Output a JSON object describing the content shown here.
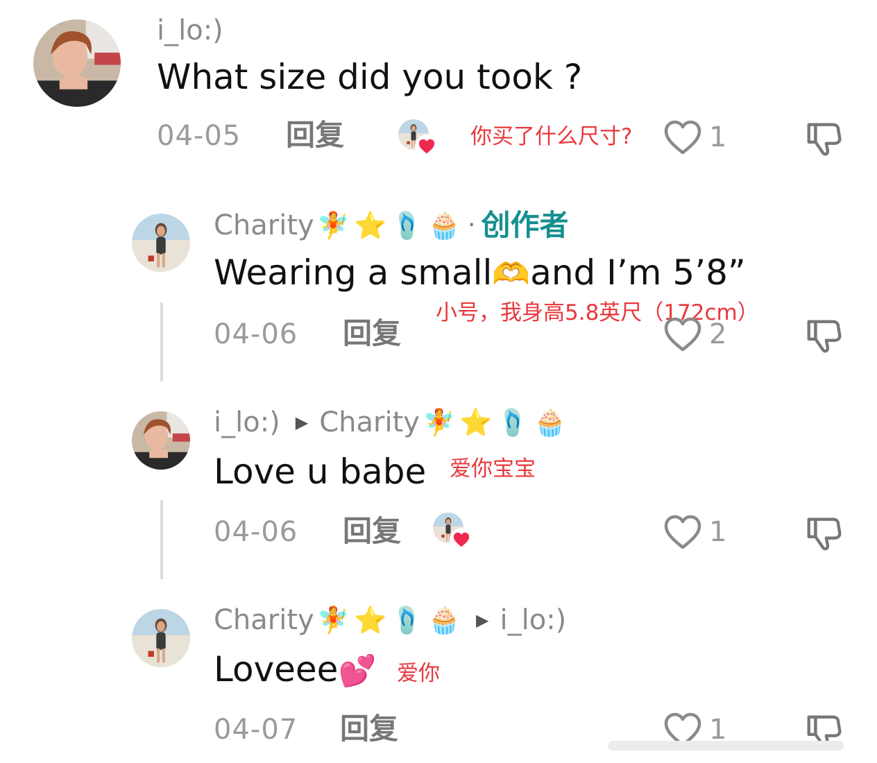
{
  "comments": [
    {
      "username": "i_lo:)",
      "text": "What size did you took ?",
      "translation": "你买了什么尺寸?",
      "date": "04-05",
      "reply_label": "回复",
      "likes": "1",
      "liked_by_creator": true
    },
    {
      "username": "Charity",
      "emojis": [
        "🧚",
        "⭐",
        "🩴",
        "🧁"
      ],
      "creator_label": "创作者",
      "text": "Wearing a small",
      "text_emoji": "🫶",
      "text_after": "and I’m 5’8”",
      "translation": "小号，我身高5.8英尺（172cm）",
      "date": "04-06",
      "reply_label": "回复",
      "likes": "2"
    },
    {
      "username": "i_lo:)",
      "reply_to": "Charity",
      "reply_to_emojis": [
        "🧚",
        "⭐",
        "🩴",
        "🧁"
      ],
      "text": "Love u babe",
      "translation": "爱你宝宝",
      "date": "04-06",
      "reply_label": "回复",
      "likes": "1",
      "liked_by_creator": true
    },
    {
      "username": "Charity",
      "emojis": [
        "🧚",
        "⭐",
        "🩴",
        "🧁"
      ],
      "reply_to": "i_lo:)",
      "text": "Loveee",
      "text_emoji": "💕",
      "translation": "爱你",
      "date": "04-07",
      "reply_label": "回复",
      "likes": "1"
    }
  ],
  "colors": {
    "username": "#8a8a8a",
    "creator": "#178f8f",
    "translation": "#e8383d",
    "heart_badge": "#f0294f"
  },
  "icons": {
    "like": "heart-outline-icon",
    "dislike": "thumbs-down-icon",
    "liked_badge": "heart-filled-icon"
  }
}
